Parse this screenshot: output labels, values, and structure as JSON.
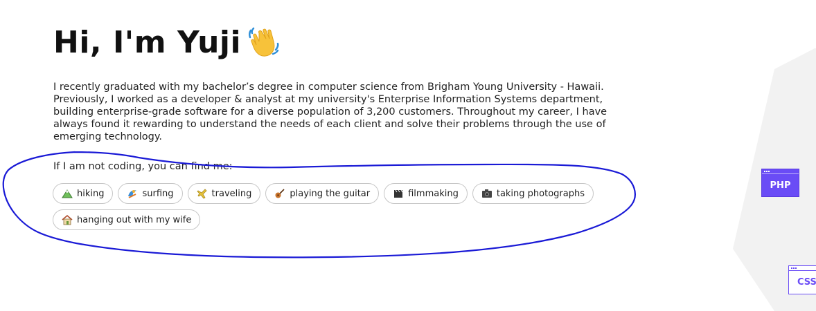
{
  "hero": {
    "title": "Hi, I'm Yuji",
    "bio": "I recently graduated with my bachelor’s degree in computer science from Brigham Young University - Hawaii. Previously, I worked as a developer & analyst at my university's Enterprise Information Systems department, building enterprise-grade software for a diverse population of 3,200 customers. Throughout my career, I have always found it rewarding to understand the needs of each client and solve their problems through the use of emerging technology.",
    "hobbies_lead": "If I am not coding, you can find me:"
  },
  "hobbies": [
    {
      "label": "hiking",
      "icon": "mountain-icon"
    },
    {
      "label": "surfing",
      "icon": "surf-icon"
    },
    {
      "label": "traveling",
      "icon": "airplane-icon"
    },
    {
      "label": "playing the guitar",
      "icon": "guitar-icon"
    },
    {
      "label": "filmmaking",
      "icon": "clapperboard-icon"
    },
    {
      "label": "taking photographs",
      "icon": "camera-icon"
    },
    {
      "label": "hanging out with my wife",
      "icon": "house-icon"
    }
  ],
  "tech_badges": {
    "php": "PHP",
    "css": "CSS"
  },
  "colors": {
    "accent": "#6a4cf6",
    "annotation": "#1a1ad6",
    "chip_border": "#c6c6c6"
  }
}
